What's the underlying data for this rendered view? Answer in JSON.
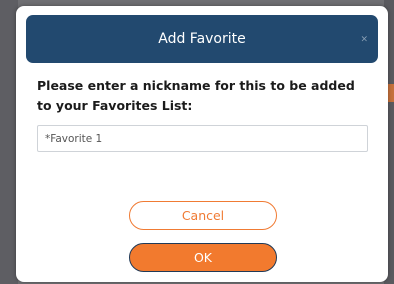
{
  "dialog": {
    "title": "Add Favorite",
    "close_glyph": "×",
    "prompt": "Please enter a nickname for this to be added to your Favorites List:",
    "input": {
      "value": "",
      "placeholder": "*Favorite 1"
    },
    "cancel_label": "Cancel",
    "ok_label": "OK"
  },
  "colors": {
    "header_bg": "#22496f",
    "accent_orange": "#f27a2e",
    "ok_border": "#213a57",
    "backdrop": "#6f6f73"
  },
  "icons": {
    "close": "close-icon"
  }
}
